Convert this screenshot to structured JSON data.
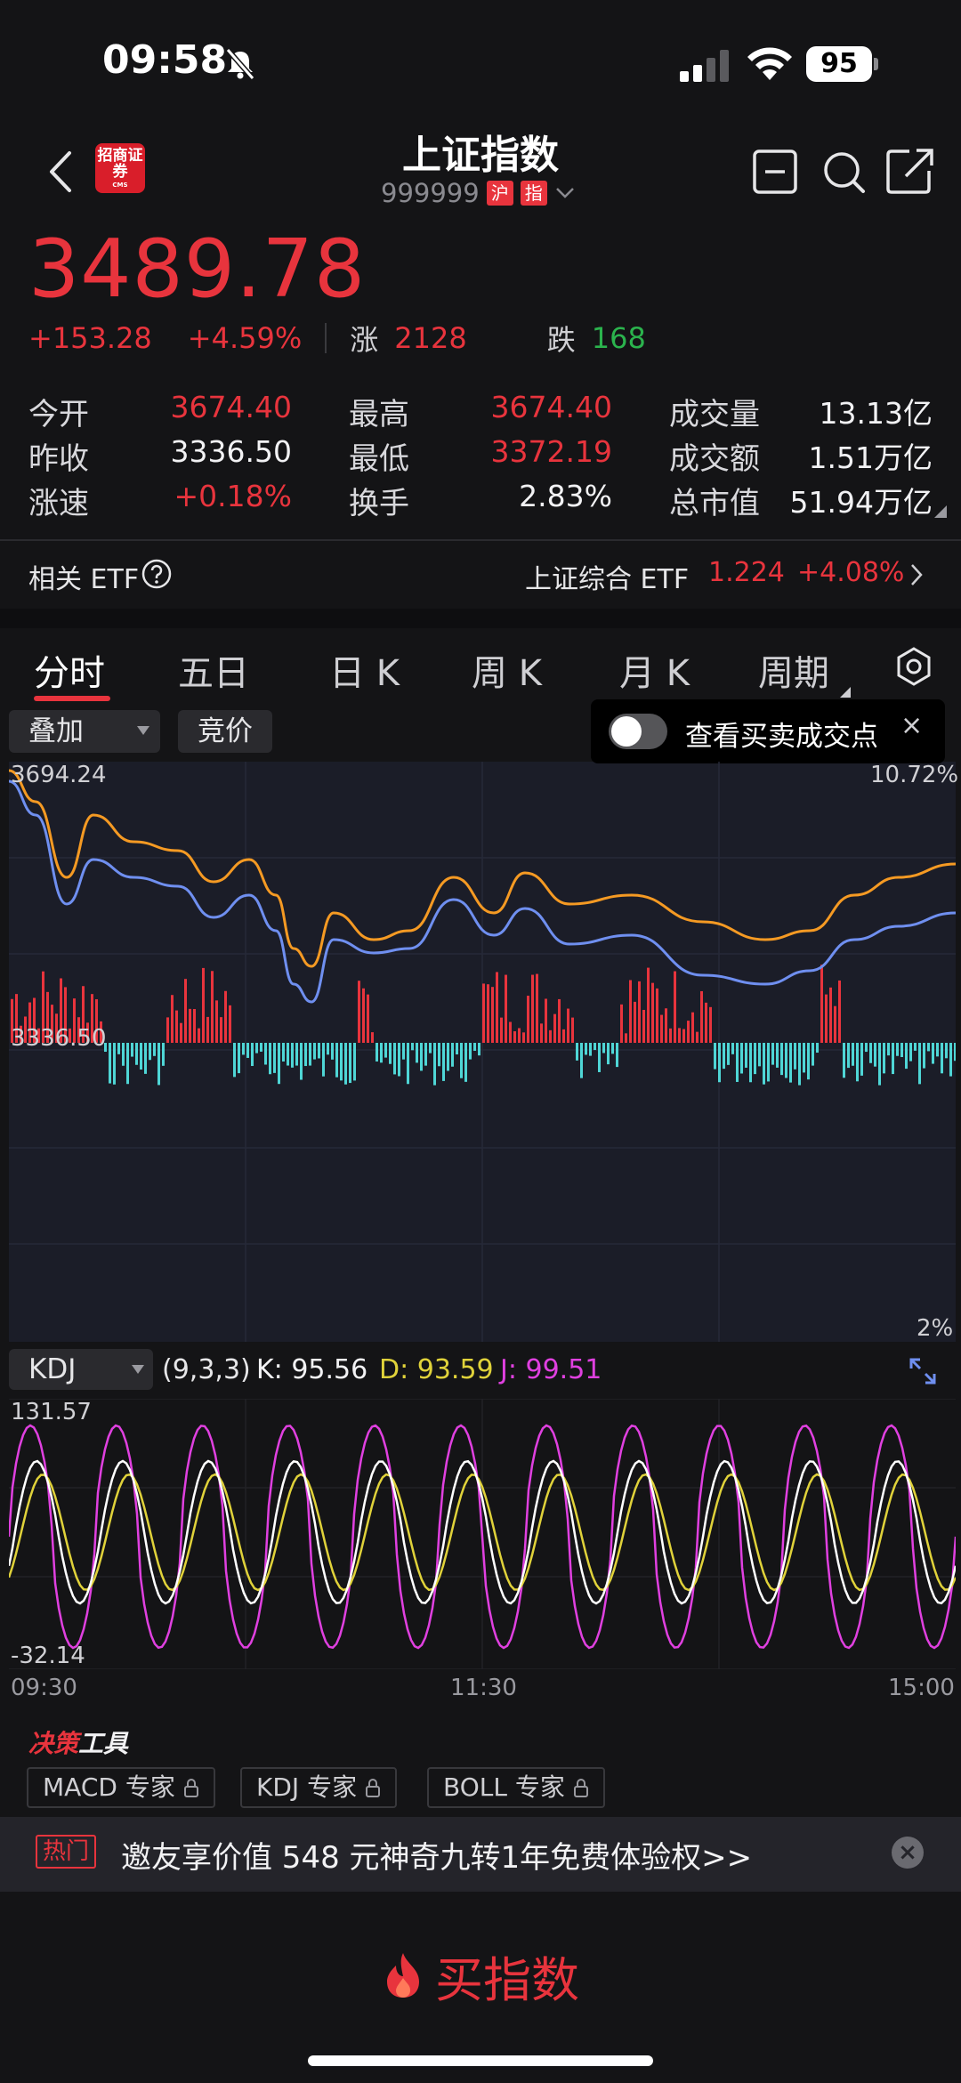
{
  "status": {
    "time": "09:58",
    "battery": "95"
  },
  "header": {
    "logo_text": "招商证券",
    "logo_sub": "CMS",
    "title": "上证指数",
    "code": "999999",
    "tags": [
      "沪",
      "指"
    ]
  },
  "quote": {
    "price": "3489.78",
    "change": "+153.28",
    "change_pct": "+4.59%",
    "up_label": "涨",
    "up_count": "2128",
    "down_label": "跌",
    "down_count": "168"
  },
  "stats": {
    "open": {
      "label": "今开",
      "value": "3674.40"
    },
    "prev_close": {
      "label": "昨收",
      "value": "3336.50"
    },
    "speed": {
      "label": "涨速",
      "value": "+0.18%"
    },
    "high": {
      "label": "最高",
      "value": "3674.40"
    },
    "low": {
      "label": "最低",
      "value": "3372.19"
    },
    "turnover": {
      "label": "换手",
      "value": "2.83%"
    },
    "volume": {
      "label": "成交量",
      "value": "13.13亿"
    },
    "amount": {
      "label": "成交额",
      "value": "1.51万亿"
    },
    "market_cap": {
      "label": "总市值",
      "value": "51.94万亿"
    }
  },
  "etf": {
    "label": "相关 ETF",
    "name": "上证综合 ETF",
    "price": "1.224",
    "change_pct": "+4.08%"
  },
  "tabs": [
    "分时",
    "五日",
    "日 K",
    "周 K",
    "月 K",
    "周期"
  ],
  "overlay": {
    "overlay_label": "叠加",
    "auction_label": "竞价",
    "trade_points_label": "查看买卖成交点",
    "close_symbol": "×"
  },
  "main_chart": {
    "y_top_label": "3694.24",
    "y_mid_label": "3336.50",
    "pct_top_label": "10.72%",
    "pct_bottom_label": "2%"
  },
  "kdj": {
    "name": "KDJ",
    "params": "(9,3,3)",
    "k_label": "K: 95.56",
    "d_label": "D: 93.59",
    "j_label": "J: 99.51",
    "y_top": "131.57",
    "y_bottom": "-32.14",
    "x_labels": [
      "09:30",
      "11:30",
      "15:00"
    ]
  },
  "tools": {
    "title_red": "决策",
    "title_white": "工具",
    "buttons": [
      "MACD 专家",
      "KDJ 专家",
      "BOLL 专家"
    ]
  },
  "promo": {
    "tag": "热门",
    "text": "邀友享价值 548 元神奇九转1年免费体验权>>"
  },
  "buy": {
    "label": "买指数"
  },
  "colors": {
    "up": "#e8343d",
    "down": "#2bb34d",
    "price_line": "#f59a23",
    "avg_line": "#6f8ff0",
    "vol_up": "#e8343d",
    "vol_down": "#4fd6d6",
    "k_line": "#ffffff",
    "d_line": "#e0d23a",
    "j_line": "#e040e0"
  }
}
